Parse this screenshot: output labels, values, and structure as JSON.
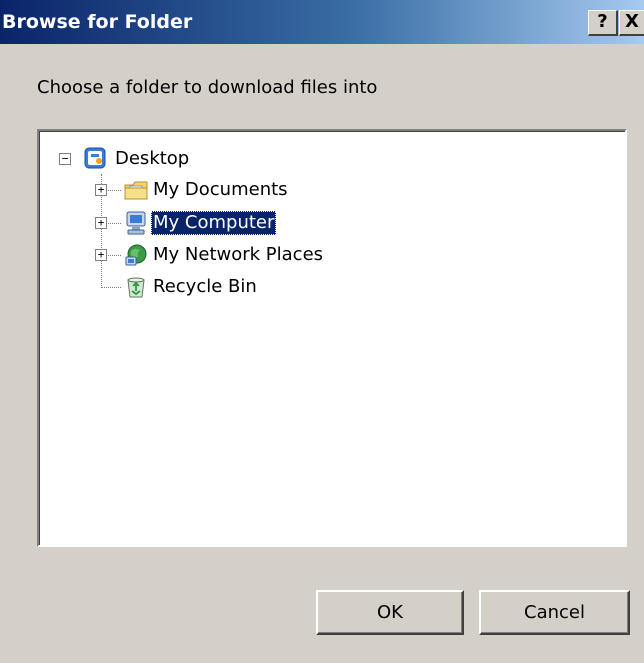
{
  "window": {
    "title": "Browse for Folder",
    "help_label": "?",
    "close_label": "X"
  },
  "prompt": "Choose a folder to download files into",
  "tree": {
    "root": {
      "label": "Desktop",
      "expander": "−",
      "icon": "desktop-icon"
    },
    "children": [
      {
        "label": "My Documents",
        "expander": "+",
        "icon": "documents-folder-icon",
        "selected": false
      },
      {
        "label": "My Computer",
        "expander": "+",
        "icon": "computer-icon",
        "selected": true
      },
      {
        "label": "My Network Places",
        "expander": "+",
        "icon": "network-places-icon",
        "selected": false
      },
      {
        "label": "Recycle Bin",
        "expander": "",
        "icon": "recycle-bin-icon",
        "selected": false
      }
    ]
  },
  "buttons": {
    "ok": "OK",
    "cancel": "Cancel"
  },
  "colors": {
    "titlebar_start": "#0a246a",
    "titlebar_end": "#a6caf0",
    "selection": "#0a246a",
    "dialog_bg": "#d4d0c8"
  }
}
